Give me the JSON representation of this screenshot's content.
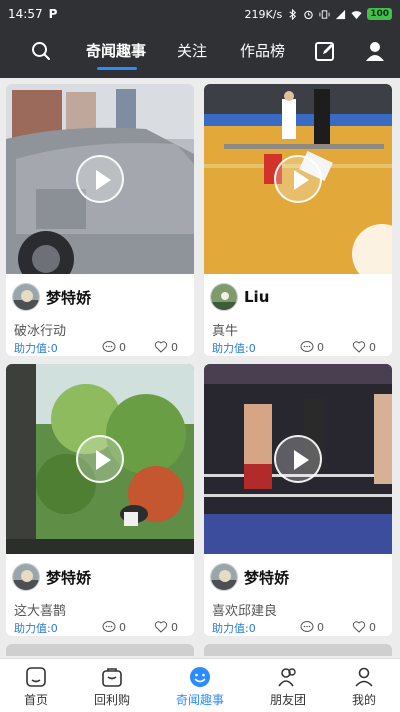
{
  "status_bar": {
    "time": "14:57",
    "app_letter": "P",
    "net_speed": "219K/s",
    "battery": "100"
  },
  "top_nav": {
    "tabs": [
      {
        "label": "奇闻趣事",
        "active": true
      },
      {
        "label": "关注",
        "active": false
      },
      {
        "label": "作品榜",
        "active": false
      }
    ],
    "accent": "#2b8cff"
  },
  "cards": [
    {
      "author": "梦特娇",
      "title": "破冰行动",
      "help_label": "助力值:0",
      "comments": "0",
      "likes": "0"
    },
    {
      "author": "Liu",
      "title": "真牛",
      "help_label": "助力值:0",
      "comments": "0",
      "likes": "0"
    },
    {
      "author": "梦特娇",
      "title": "这大喜鹊",
      "help_label": "助力值:0",
      "comments": "0",
      "likes": "0"
    },
    {
      "author": "梦特娇",
      "title": "喜欢邱建良",
      "help_label": "助力值:0",
      "comments": "0",
      "likes": "0"
    }
  ],
  "bottom_tabs": [
    {
      "label": "首页",
      "icon": "home-icon",
      "active": false
    },
    {
      "label": "回利购",
      "icon": "shopping-bag-icon",
      "active": false
    },
    {
      "label": "奇闻趣事",
      "icon": "smile-icon",
      "active": true
    },
    {
      "label": "朋友团",
      "icon": "friends-icon",
      "active": false
    },
    {
      "label": "我的",
      "icon": "profile-icon",
      "active": false
    }
  ]
}
